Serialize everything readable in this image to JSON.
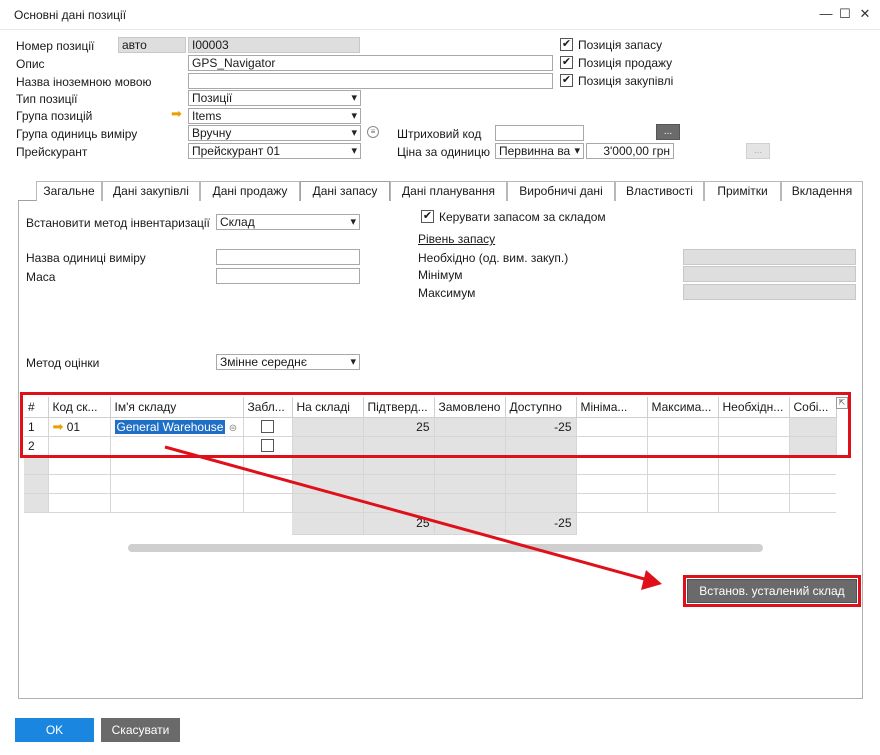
{
  "window": {
    "title": "Основні дані позиції",
    "min": "—",
    "max": "☐",
    "close": "✕"
  },
  "header": {
    "item_no_label": "Номер позиції",
    "item_no_mode": "авто",
    "item_no": "I00003",
    "desc_label": "Опис",
    "desc": "GPS_Navigator",
    "foreign_label": "Назва іноземною мовою",
    "foreign": "",
    "type_label": "Тип позиції",
    "type": "Позиції",
    "group_label": "Група позицій",
    "group": "Items",
    "uom_group_label": "Група одиниць виміру",
    "uom_group": "Вручну",
    "price_list_label": "Прейскурант",
    "price_list": "Прейскурант 01",
    "barcode_label": "Штриховий код",
    "barcode": "",
    "unit_price_label": "Ціна за одиницю",
    "price_type": "Первинна ва",
    "unit_price": "3'000,00 грн",
    "inventory_item": "Позиція запасу",
    "sales_item": "Позиція продажу",
    "purchase_item": "Позиція закупівлі",
    "dots": "..."
  },
  "tabs": [
    "Загальне",
    "Дані закупівлі",
    "Дані продажу",
    "Дані запасу",
    "Дані планування",
    "Виробничі дані",
    "Властивості",
    "Примітки",
    "Вкладення"
  ],
  "inventory": {
    "method_label": "Встановити метод інвентаризації",
    "method": "Склад",
    "manage_by_wh": "Керувати запасом за складом",
    "uom_name_label": "Назва одиниці виміру",
    "weight_label": "Маса",
    "stock_level": "Рівень запасу",
    "required_label": "Необхідно (од. вим. закуп.)",
    "min_label": "Мінімум",
    "max_label": "Максимум",
    "valuation_label": "Метод оцінки",
    "valuation": "Змінне середнє"
  },
  "grid": {
    "columns": [
      "#",
      "Код ск...",
      "Ім'я складу",
      "Забл...",
      "На складі",
      "Підтверд...",
      "Замовлено",
      "Доступно",
      "Мініма...",
      "Максима...",
      "Необхідн...",
      "Собі..."
    ],
    "rows": [
      {
        "n": "1",
        "code": "01",
        "name": "General Warehouse",
        "committed": "25",
        "available": "-25"
      },
      {
        "n": "2",
        "code": "",
        "name": "",
        "committed": "",
        "available": ""
      }
    ],
    "totals": {
      "committed": "25",
      "available": "-25"
    }
  },
  "buttons": {
    "set_default_wh": "Встанов. усталений склад",
    "ok": "OK",
    "cancel": "Скасувати"
  },
  "colors": {
    "accent": "#1b86e0",
    "annotation": "#e0101a",
    "selection": "#1f6fc6"
  }
}
